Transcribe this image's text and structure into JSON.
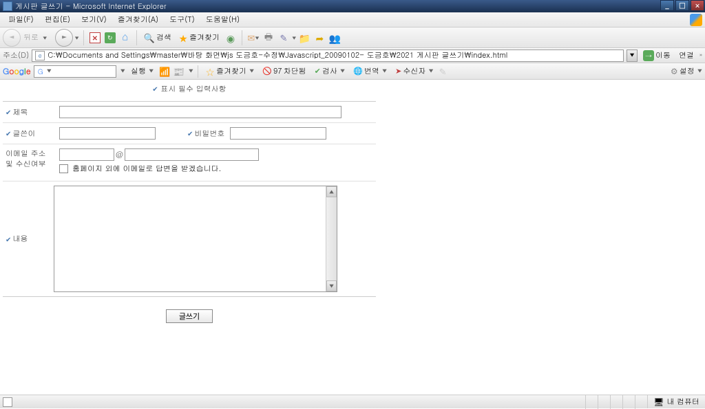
{
  "window": {
    "title": "게시판 글쓰기 - Microsoft Internet Explorer",
    "minimize": "_",
    "maximize": "□",
    "close": "×"
  },
  "menubar": {
    "file": "파일(F)",
    "edit": "편집(E)",
    "view": "보기(V)",
    "favorites": "즐겨찾기(A)",
    "tools": "도구(T)",
    "help": "도움말(H)"
  },
  "toolbar": {
    "back": "뒤로",
    "search": "검색",
    "favorites": "즐겨찾기"
  },
  "address": {
    "label": "주소(D)",
    "value": "C:\\Documents and Settings\\master\\바탕 화면\\js 도금호-수정\\Javascript_20090102- 도금호\\2021 게시판 글쓰기\\index.html",
    "go": "이동",
    "links": "연결"
  },
  "google": {
    "logo_g1": "G",
    "logo_o1": "o",
    "logo_o2": "o",
    "logo_g2": "g",
    "logo_l": "l",
    "logo_e": "e",
    "search_prefix": "G",
    "run": "실행",
    "bookmark": "즐겨찾기",
    "blocked_count": "97",
    "blocked": "차단됨",
    "check": "검사",
    "translate": "번역",
    "sender": "수신자",
    "settings": "설정"
  },
  "form": {
    "required_note": "표시 필수 입력사항",
    "title_label": "제목",
    "author_label": "글쓴이",
    "password_label": "비밀번호",
    "email_label_line1": "이메일 주소",
    "email_label_line2": "및 수신여부",
    "at": "@",
    "email_checkbox_text": "홈페이지 외에 이메일로 답변을 받겠습니다.",
    "content_label": "내용",
    "submit": "글쓰기"
  },
  "status": {
    "zone": "내 컴퓨터"
  }
}
